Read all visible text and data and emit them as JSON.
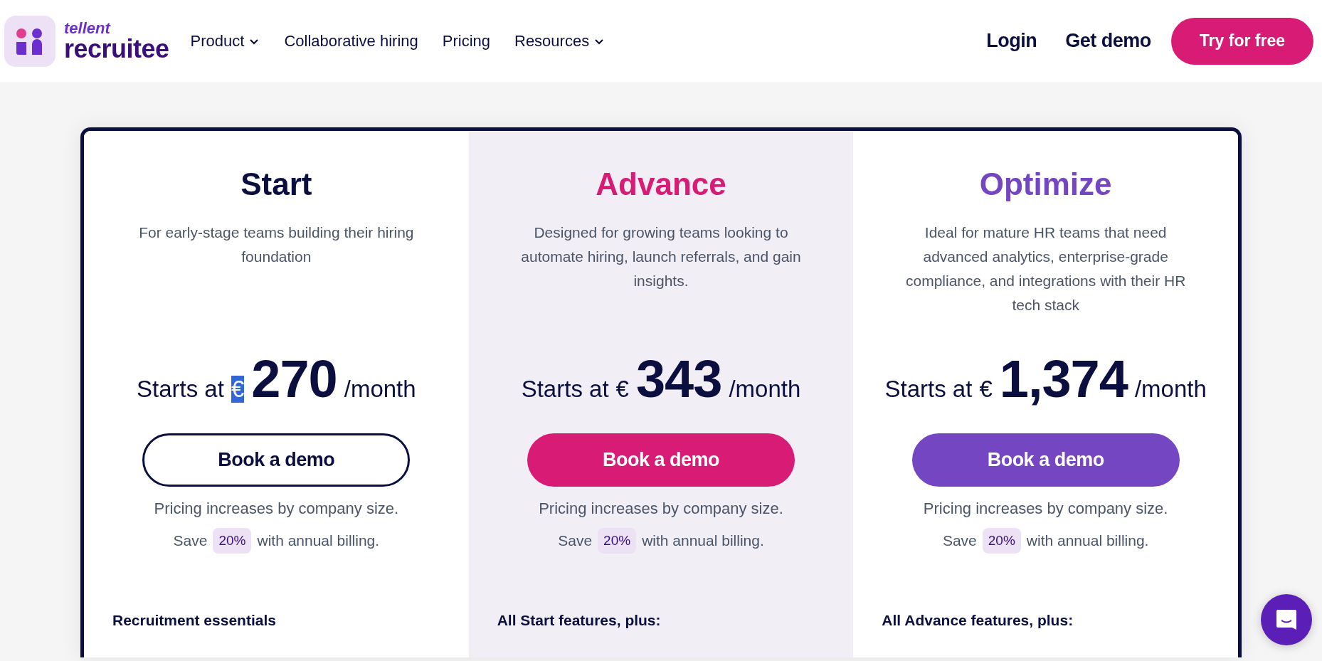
{
  "header": {
    "logo": {
      "brand": "tellent",
      "product": "recruitee"
    },
    "nav": [
      {
        "label": "Product",
        "dropdown": true
      },
      {
        "label": "Collaborative hiring",
        "dropdown": false
      },
      {
        "label": "Pricing",
        "dropdown": false
      },
      {
        "label": "Resources",
        "dropdown": true
      }
    ],
    "login": "Login",
    "get_demo": "Get demo",
    "try_free": "Try for free"
  },
  "plans": [
    {
      "name": "Start",
      "kind": "outline",
      "description": "For early-stage teams building their hiring foundation",
      "starts_at": "Starts at",
      "currency": "€",
      "currency_highlighted": true,
      "price": "270",
      "period": "/month",
      "button": "Book a demo",
      "note": "Pricing increases by company size.",
      "save_prefix": "Save",
      "save_badge": "20%",
      "save_suffix": "with annual billing.",
      "features_heading": "Recruitment essentials"
    },
    {
      "name": "Advance",
      "kind": "pink",
      "description": "Designed for growing teams looking to automate hiring, launch referrals, and gain insights.",
      "starts_at": "Starts at",
      "currency": "€",
      "currency_highlighted": false,
      "price": "343",
      "period": "/month",
      "button": "Book a demo",
      "note": "Pricing increases by company size.",
      "save_prefix": "Save",
      "save_badge": "20%",
      "save_suffix": "with annual billing.",
      "features_heading": "All Start features, plus:"
    },
    {
      "name": "Optimize",
      "kind": "purple",
      "description": "Ideal for mature HR teams that need advanced analytics, enterprise-grade compliance, and integrations with their HR tech stack",
      "starts_at": "Starts at",
      "currency": "€",
      "currency_highlighted": false,
      "price": "1,374",
      "period": "/month",
      "button": "Book a demo",
      "note": "Pricing increases by company size.",
      "save_prefix": "Save",
      "save_badge": "20%",
      "save_suffix": "with annual billing.",
      "features_heading": "All Advance features, plus:"
    }
  ]
}
